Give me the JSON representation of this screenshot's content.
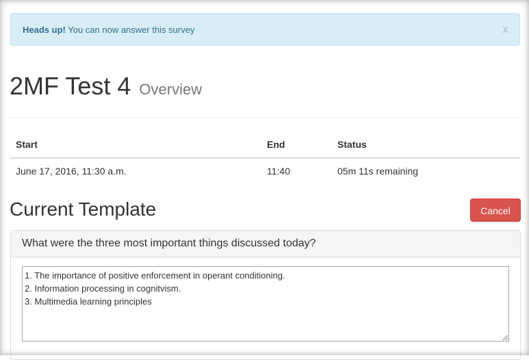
{
  "alert": {
    "strong": "Heads up!",
    "message": "You can now answer this survey",
    "close": "x"
  },
  "header": {
    "title": "2MF Test 4",
    "subtitle": "Overview"
  },
  "schedule": {
    "columns": [
      "Start",
      "End",
      "Status"
    ],
    "rows": [
      [
        "June 17, 2016, 11:30 a.m.",
        "11:40",
        "05m 11s remaining"
      ]
    ]
  },
  "template": {
    "title": "Current Template",
    "cancel_label": "Cancel",
    "question": "What were the three most important things discussed today?",
    "answer": "1. The importance of positive enforcement in operant conditioning.\n2. Information processing in cognitvism.\n3. Multimedia learning principles"
  },
  "colors": {
    "alert_bg": "#d9edf7",
    "alert_text": "#31708f",
    "danger": "#d9534f"
  }
}
